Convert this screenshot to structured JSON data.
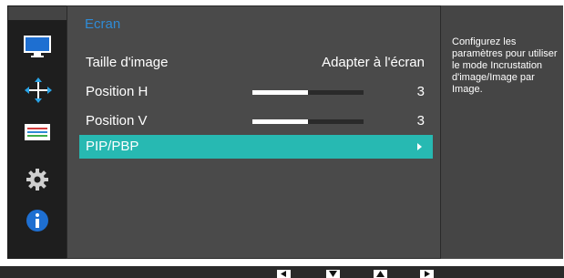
{
  "sidebar": {
    "icons": [
      "monitor-icon",
      "position-arrows-icon",
      "color-bars-icon",
      "gear-icon",
      "info-icon"
    ],
    "active_index": 1
  },
  "menu": {
    "title": "Ecran",
    "rows": [
      {
        "label": "Taille d'image",
        "value": "Adapter à l'écran"
      },
      {
        "label": "Position H",
        "value": "3",
        "level": 0.5
      },
      {
        "label": "Position V",
        "value": "3",
        "level": 0.5
      },
      {
        "label": "PIP/PBP",
        "selected": true
      }
    ]
  },
  "help": {
    "text": "Configurez les paramètres pour utiliser le mode Incrustation d'image/Image par Image."
  },
  "navbar": {
    "buttons": [
      "left-arrow-icon",
      "down-arrow-icon",
      "up-arrow-icon",
      "right-arrow-icon"
    ]
  },
  "colors": {
    "accent": "#27b9b2",
    "title": "#2f8bd6"
  }
}
